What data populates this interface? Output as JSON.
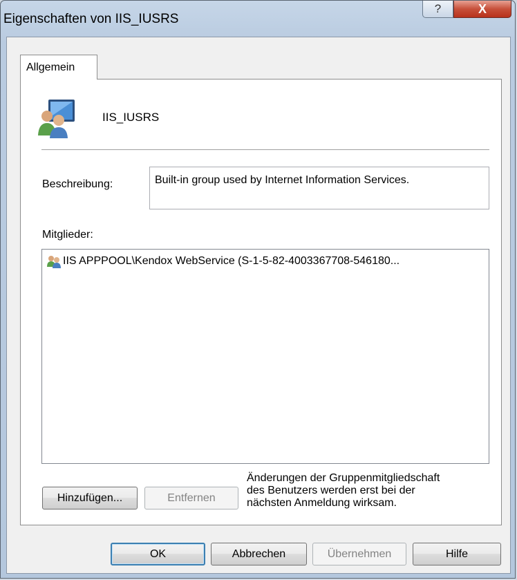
{
  "window": {
    "title": "Eigenschaften von IIS_IUSRS",
    "help_glyph": "?",
    "close_glyph": "X"
  },
  "tabs": [
    {
      "label": "Allgemein",
      "active": true
    }
  ],
  "general": {
    "group_name": "IIS_IUSRS",
    "description_label": "Beschreibung:",
    "description_value": "Built-in group used by Internet Information Services.",
    "members_label": "Mitglieder:",
    "members": [
      {
        "icon": "user-group-icon",
        "text": "IIS APPPOOL\\Kendox WebService (S-1-5-82-4003367708-546180..."
      }
    ],
    "add_button": "Hinzufügen...",
    "remove_button": "Entfernen",
    "note": [
      "Änderungen der Gruppenmitgliedschaft",
      "des Benutzers werden erst bei der",
      "nächsten Anmeldung wirksam."
    ]
  },
  "footer": {
    "ok": "OK",
    "cancel": "Abbrechen",
    "apply": "Übernehmen",
    "help": "Hilfe"
  },
  "colors": {
    "title_frame": "#b9cbe0",
    "close_button": "#c7503a",
    "default_button_border": "#3c7fb1"
  }
}
